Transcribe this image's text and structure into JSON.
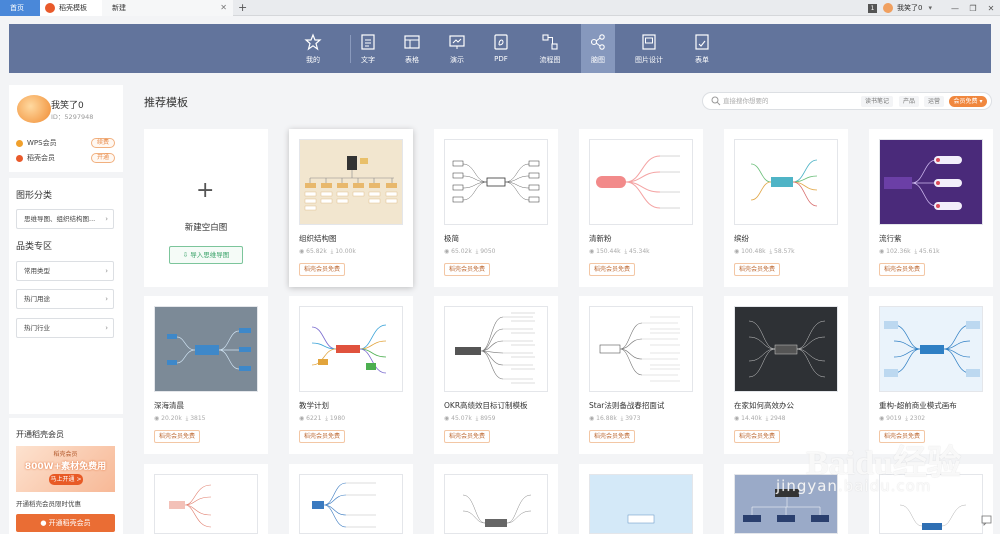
{
  "tabs": {
    "home": "首页",
    "daoke": "稻壳模板",
    "new_tab": "新建"
  },
  "titlebar": {
    "badge": "1",
    "user": "我笑了0"
  },
  "toolbar": [
    "我的",
    "文字",
    "表格",
    "演示",
    "PDF",
    "流程图",
    "脑图",
    "图片设计",
    "表单"
  ],
  "active_tool": "脑图",
  "user": {
    "name": "我笑了0",
    "id": "ID：5297948"
  },
  "memberships": [
    {
      "name": "WPS会员",
      "action": "续费",
      "color": "#f0a02c"
    },
    {
      "name": "稻壳会员",
      "action": "开通",
      "color": "#e95a2b"
    }
  ],
  "categories": {
    "graph_title": "图形分类",
    "graph_select": "思维导图、组织结构图...",
    "zone_title": "品类专区",
    "zone_selects": [
      "常用类型",
      "热门用途",
      "热门行业"
    ]
  },
  "vip": {
    "title": "开通稻壳会员",
    "banner_top": "稻壳会员",
    "banner_main": "800W+素材免费用",
    "banner_btn": "马上开通 >",
    "desc": "开通稻壳会员限时优惠",
    "open_btn": "开通稻壳会员"
  },
  "main": {
    "title": "推荐模板",
    "search_placeholder": "直接搜你想要的",
    "search_tags": [
      "读书笔记",
      "产品",
      "运营"
    ],
    "vip_tag": "会员免费 ▾",
    "blank_label": "新建空白图",
    "import_label": "导入思维导图"
  },
  "badge_text": "稻壳会员免费",
  "templates": [
    {
      "name": "组织结构图",
      "views": "65.82k",
      "downloads": "10.00k"
    },
    {
      "name": "极简",
      "views": "65.02k",
      "downloads": "9050"
    },
    {
      "name": "清新粉",
      "views": "150.44k",
      "downloads": "45.34k"
    },
    {
      "name": "缤纷",
      "views": "100.48k",
      "downloads": "58.57k"
    },
    {
      "name": "流行紫",
      "views": "102.36k",
      "downloads": "45.61k"
    },
    {
      "name": "深海清晨",
      "views": "20.20k",
      "downloads": "3815"
    },
    {
      "name": "教学计划",
      "views": "6221",
      "downloads": "1980"
    },
    {
      "name": "OKR高绩效目标订制模板",
      "views": "45.07k",
      "downloads": "8959"
    },
    {
      "name": "Star法则备战春招面试",
      "views": "16.88k",
      "downloads": "3973"
    },
    {
      "name": "在家如何高效办公",
      "views": "14.40k",
      "downloads": "2948"
    },
    {
      "name": "重构-超前商业模式画布",
      "views": "9019",
      "downloads": "2302"
    }
  ],
  "watermark": {
    "brand": "Baidu经验",
    "url": "jingyan.baidu.com"
  }
}
